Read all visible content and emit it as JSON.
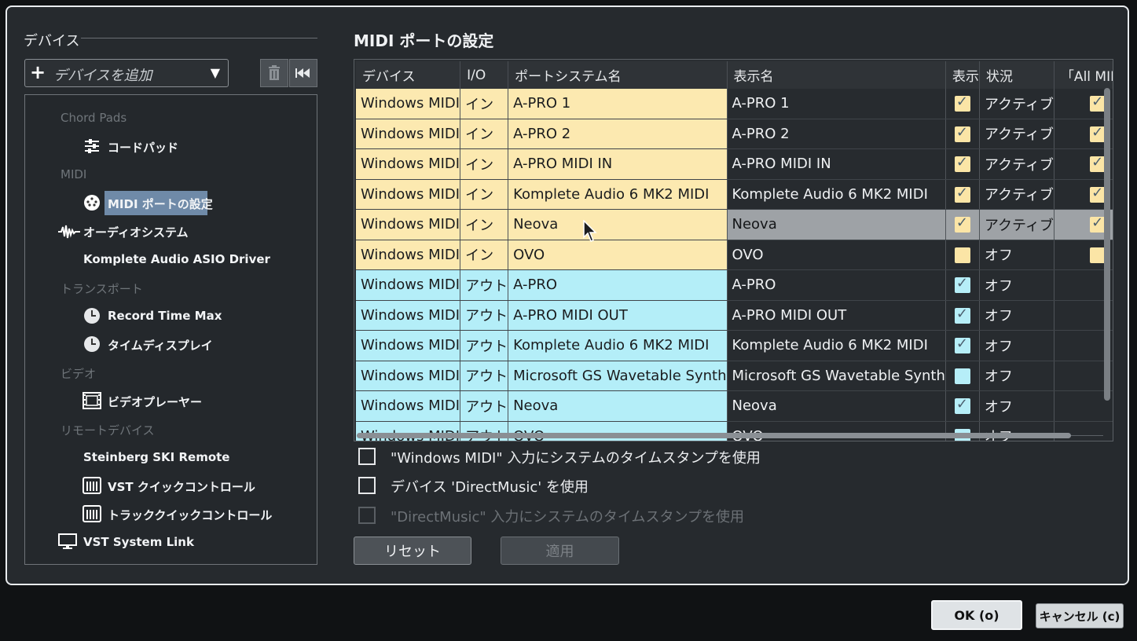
{
  "left": {
    "section_title": "デバイス",
    "add_device": "デバイスを追加",
    "tree": [
      {
        "type": "cat",
        "label": "Chord Pads"
      },
      {
        "type": "item",
        "label": "コードパッド",
        "icon": "chord-pads-icon"
      },
      {
        "type": "cat",
        "label": "MIDI"
      },
      {
        "type": "item",
        "label": "MIDI ポートの設定",
        "icon": "midi-port-icon",
        "selected": true
      },
      {
        "type": "item",
        "label": "オーディオシステム",
        "icon": "audio-wave-icon"
      },
      {
        "type": "item",
        "label": "Komplete Audio ASIO Driver",
        "icon": ""
      },
      {
        "type": "cat",
        "label": "トランスポート"
      },
      {
        "type": "item",
        "label": "Record Time Max",
        "icon": "clock-icon"
      },
      {
        "type": "item",
        "label": "タイムディスプレイ",
        "icon": "clock-icon"
      },
      {
        "type": "cat",
        "label": "ビデオ"
      },
      {
        "type": "item",
        "label": "ビデオプレーヤー",
        "icon": "film-icon"
      },
      {
        "type": "cat",
        "label": "リモートデバイス"
      },
      {
        "type": "item",
        "label": "Steinberg SKI Remote",
        "icon": ""
      },
      {
        "type": "item",
        "label": "VST クイックコントロール",
        "icon": "quick-control-icon"
      },
      {
        "type": "item",
        "label": "トラッククイックコントロール",
        "icon": "quick-control-icon"
      },
      {
        "type": "item",
        "label": "VST System Link",
        "icon": "monitor-icon"
      }
    ]
  },
  "right": {
    "title": "MIDI ポートの設定",
    "columns": [
      "デバイス",
      "I/O",
      "ポートシステム名",
      "表示名",
      "表示",
      "状況",
      "「All MIDI In"
    ],
    "rows": [
      {
        "dir": "in",
        "device": "Windows MIDI",
        "io": "イン",
        "port": "A-PRO 1",
        "display": "A-PRO 1",
        "visible": true,
        "status": "アクティブ",
        "all": true
      },
      {
        "dir": "in",
        "device": "Windows MIDI",
        "io": "イン",
        "port": "A-PRO 2",
        "display": "A-PRO 2",
        "visible": true,
        "status": "アクティブ",
        "all": true
      },
      {
        "dir": "in",
        "device": "Windows MIDI",
        "io": "イン",
        "port": "A-PRO MIDI IN",
        "display": "A-PRO MIDI IN",
        "visible": true,
        "status": "アクティブ",
        "all": true
      },
      {
        "dir": "in",
        "device": "Windows MIDI",
        "io": "イン",
        "port": "Komplete Audio 6 MK2 MIDI",
        "display": "Komplete Audio 6 MK2 MIDI",
        "visible": true,
        "status": "アクティブ",
        "all": true
      },
      {
        "dir": "in",
        "device": "Windows MIDI",
        "io": "イン",
        "port": "Neova",
        "display": "Neova",
        "visible": true,
        "status": "アクティブ",
        "all": true,
        "highlight": true
      },
      {
        "dir": "in",
        "device": "Windows MIDI",
        "io": "イン",
        "port": "OVO",
        "display": "OVO",
        "visible": false,
        "status": "オフ",
        "all": false
      },
      {
        "dir": "out",
        "device": "Windows MIDI",
        "io": "アウト",
        "port": "A-PRO",
        "display": "A-PRO",
        "visible": true,
        "status": "オフ",
        "all": null
      },
      {
        "dir": "out",
        "device": "Windows MIDI",
        "io": "アウト",
        "port": "A-PRO MIDI OUT",
        "display": "A-PRO MIDI OUT",
        "visible": true,
        "status": "オフ",
        "all": null
      },
      {
        "dir": "out",
        "device": "Windows MIDI",
        "io": "アウト",
        "port": "Komplete Audio 6 MK2 MIDI",
        "display": "Komplete Audio 6 MK2 MIDI",
        "visible": true,
        "status": "オフ",
        "all": null
      },
      {
        "dir": "out",
        "device": "Windows MIDI",
        "io": "アウト",
        "port": "Microsoft GS Wavetable Synth",
        "display": "Microsoft GS Wavetable Synth",
        "visible": false,
        "status": "オフ",
        "all": null
      },
      {
        "dir": "out",
        "device": "Windows MIDI",
        "io": "アウト",
        "port": "Neova",
        "display": "Neova",
        "visible": true,
        "status": "オフ",
        "all": null
      },
      {
        "dir": "out",
        "device": "Windows MIDI",
        "io": "アウト",
        "port": "OVO",
        "display": "OVO",
        "visible": false,
        "status": "オフ",
        "all": null
      }
    ],
    "options": [
      {
        "label": "\"Windows MIDI\" 入力にシステムのタイムスタンプを使用",
        "checked": false,
        "disabled": false
      },
      {
        "label": "デバイス 'DirectMusic' を使用",
        "checked": false,
        "disabled": false
      },
      {
        "label": "\"DirectMusic\" 入力にシステムのタイムスタンプを使用",
        "checked": false,
        "disabled": true
      }
    ],
    "reset_label": "リセット",
    "apply_label": "適用"
  },
  "footer": {
    "ok_label": "OK (o)",
    "cancel_label": "キャンセル (c)"
  },
  "colors": {
    "input_row": "#fce9b0",
    "output_row": "#b4eef8",
    "selected_item": "#6f8aa8",
    "highlight_row": "#9ea2a6"
  }
}
